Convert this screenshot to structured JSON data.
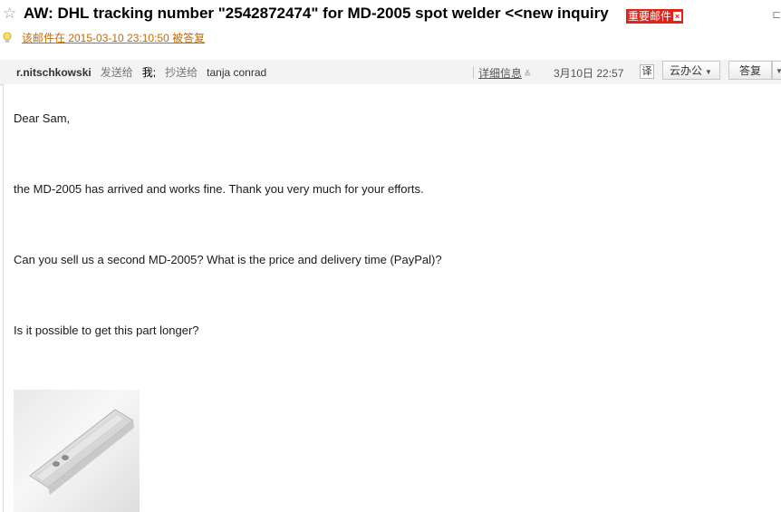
{
  "email": {
    "subject": "AW: DHL tracking number \"2542872474\" for MD-2005 spot welder <<new inquiry",
    "badge": "重要邮件",
    "badge_close": "×",
    "sent_note": "该邮件在 2015-03-10 23:10:50 被答复"
  },
  "meta": {
    "sender": "r.nitschkowski",
    "sent_to_label": "发送给",
    "me": "我;",
    "cc_label": "抄送给",
    "cc": "tanja conrad",
    "details": "详细信息",
    "date": "3月10日 22:57",
    "translate": "译",
    "cloud_office": "云办公",
    "reply": "答复"
  },
  "body": {
    "greeting": "Dear Sam,",
    "line1": "the MD-2005 has arrived and works fine. Thank you very much for your efforts.",
    "line2": "Can you sell us a second MD-2005? What is the price and delivery time (PayPal)?",
    "line3": "Is it possible to get this part longer?"
  },
  "icons": {
    "star": "star-icon",
    "bulb": "lightbulb-icon",
    "details_chevron": "double-chevron-down-icon",
    "dropdown": "caret-down-icon"
  },
  "colors": {
    "badge": "#e2231a",
    "sent_note": "#c36b00",
    "meta_bar": "#f3f3f3"
  }
}
